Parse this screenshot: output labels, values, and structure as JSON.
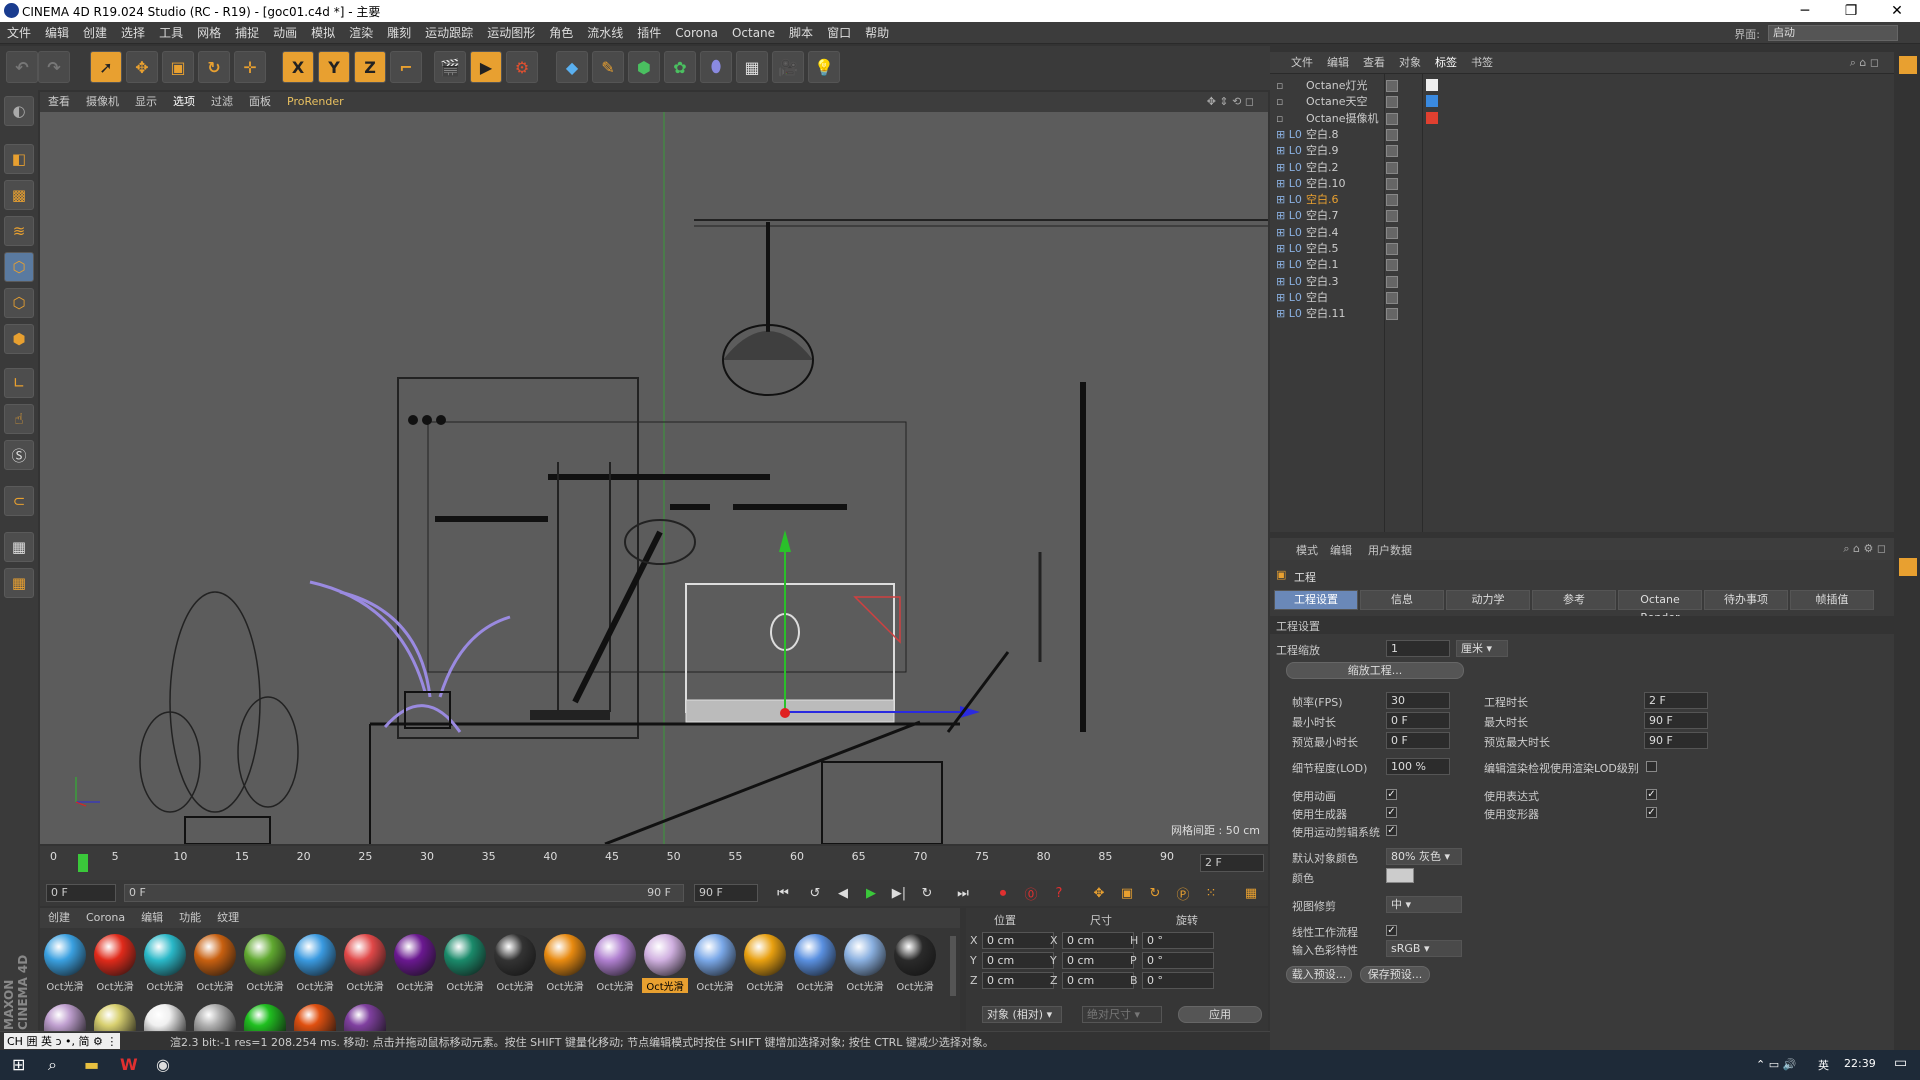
{
  "title": "CINEMA 4D R19.024 Studio (RC - R19) - [goc01.c4d *] - 主要",
  "menu": [
    "文件",
    "编辑",
    "创建",
    "选择",
    "工具",
    "网格",
    "捕捉",
    "动画",
    "模拟",
    "渲染",
    "雕刻",
    "运动跟踪",
    "运动图形",
    "角色",
    "流水线",
    "插件",
    "Corona",
    "Octane",
    "脚本",
    "窗口",
    "帮助"
  ],
  "layout": {
    "label": "界面:",
    "value": "启动"
  },
  "viewport_menu": [
    "查看",
    "摄像机",
    "显示",
    "选项",
    "过滤",
    "面板",
    "ProRender"
  ],
  "grid_label": "网格间距 : 50 cm",
  "timeline": {
    "ticks": [
      "0",
      "5",
      "10",
      "15",
      "20",
      "25",
      "30",
      "35",
      "40",
      "45",
      "50",
      "55",
      "60",
      "65",
      "70",
      "75",
      "80",
      "85",
      "90"
    ],
    "current": "2",
    "frame_field": "2 F"
  },
  "transport": {
    "start": "0 F",
    "range_start": "0 F",
    "range_end": "90 F",
    "end": "90 F"
  },
  "material_menu": [
    "创建",
    "Corona",
    "编辑",
    "功能",
    "纹理"
  ],
  "materials": [
    {
      "label": "Oct光滑",
      "color": "#3aa0e0"
    },
    {
      "label": "Oct光滑",
      "color": "#e02a1a"
    },
    {
      "label": "Oct光滑",
      "color": "#2ab8c8"
    },
    {
      "label": "Oct光滑",
      "color": "#c86010"
    },
    {
      "label": "Oct光滑",
      "color": "#60a830"
    },
    {
      "label": "Oct光滑",
      "color": "#3a9ae0"
    },
    {
      "label": "Oct光滑",
      "color": "#e04848"
    },
    {
      "label": "Oct光滑",
      "color": "#6a1890"
    },
    {
      "label": "Oct光滑",
      "color": "#1a8a6a"
    },
    {
      "label": "Oct光滑",
      "color": "#333333"
    },
    {
      "label": "Oct光滑",
      "color": "#e88a10"
    },
    {
      "label": "Oct光滑",
      "color": "#b080d0"
    },
    {
      "label": "Oct光滑",
      "color": "#d0b0e0",
      "selected": true
    },
    {
      "label": "Oct光滑",
      "color": "#7aa8e8"
    },
    {
      "label": "Oct光滑",
      "color": "#e8a010"
    },
    {
      "label": "Oct光滑",
      "color": "#5a90e0"
    },
    {
      "label": "Oct光滑",
      "color": "#8ab0e0"
    },
    {
      "label": "Oct光滑",
      "color": "#2a2a2a"
    }
  ],
  "materials_row2": [
    "#c0a0d0",
    "#d8d070",
    "#f0f0f0",
    "#b0b0b0",
    "#20c020",
    "#e05010",
    "#8040a0"
  ],
  "coords": {
    "headers": [
      "位置",
      "尺寸",
      "旋转"
    ],
    "rows": [
      {
        "a": "X",
        "av": "0 cm",
        "b": "X",
        "bv": "0 cm",
        "c": "H",
        "cv": "0 °"
      },
      {
        "a": "Y",
        "av": "0 cm",
        "b": "Y",
        "bv": "0 cm",
        "c": "P",
        "cv": "0 °"
      },
      {
        "a": "Z",
        "av": "0 cm",
        "b": "Z",
        "bv": "0 cm",
        "c": "B",
        "cv": "0 °"
      }
    ],
    "mode": "对象 (相对)",
    "size_mode": "绝对尺寸",
    "apply": "应用"
  },
  "status": "渲2.3  bit:-1 res=1  208.254 ms.   移动: 点击并拖动鼠标移动元素。按住 SHIFT 键量化移动; 节点编辑模式时按住 SHIFT 键增加选择对象; 按住 CTRL 键减少选择对象。",
  "object_menu": [
    "文件",
    "编辑",
    "查看",
    "对象",
    "标签",
    "书签"
  ],
  "objects": [
    "Octane灯光",
    "Octane天空",
    "Octane摄像机",
    "空白.8",
    "空白.9",
    "空白.2",
    "空白.10",
    "空白.6",
    "空白.7",
    "空白.4",
    "空白.5",
    "空白.1",
    "空白.3",
    "空白",
    "空白.11"
  ],
  "attr_menu": [
    "模式",
    "编辑",
    "用户数据"
  ],
  "attr_title": "工程",
  "attr_tabs": [
    "工程设置",
    "信息",
    "动力学",
    "参考",
    "Octane Render",
    "待办事项",
    "帧插值"
  ],
  "section": "工程设置",
  "project": {
    "scale_label": "工程缩放",
    "scale": "1",
    "unit": "厘米",
    "scale_btn": "缩放工程...",
    "fps_label": "帧率(FPS)",
    "fps": "30",
    "time_label": "工程时长",
    "time": "2 F",
    "min_label": "最小时长",
    "min": "0 F",
    "max_label": "最大时长",
    "max": "90 F",
    "pmin_label": "预览最小时长",
    "pmin": "0 F",
    "pmax_label": "预览最大时长",
    "pmax": "90 F",
    "lod_label": "细节程度(LOD)",
    "lod": "100 %",
    "lod_r": "编辑渲染检视使用渲染LOD级别",
    "anim": "使用动画",
    "expr": "使用表达式",
    "gen": "使用生成器",
    "deform": "使用变形器",
    "motion": "使用运动剪辑系统",
    "defcolor_label": "默认对象颜色",
    "defcolor": "80% 灰色",
    "color_label": "颜色",
    "clip_label": "视图修剪",
    "clip": "中",
    "linear": "线性工作流程",
    "input_label": "输入色彩特性",
    "input": "sRGB",
    "load": "载入预设...",
    "save": "保存预设..."
  },
  "taskbar": {
    "time": "22:39",
    "ime": "英"
  }
}
